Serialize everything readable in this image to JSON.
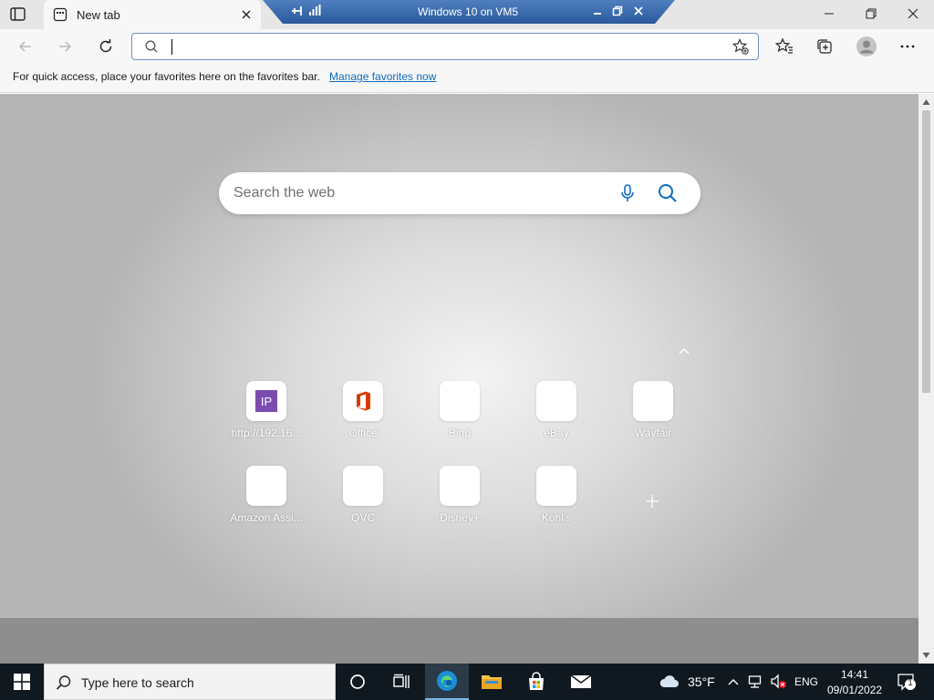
{
  "tab": {
    "title": "New tab"
  },
  "vm_bar": {
    "title": "Windows 10 on VM5"
  },
  "address": {
    "value": ""
  },
  "favorites_bar": {
    "message": "For quick access, place your favorites here on the favorites bar.",
    "link": "Manage favorites now"
  },
  "search": {
    "placeholder": "Search the web"
  },
  "quick_links": [
    {
      "label": "http://192.16...",
      "icon": "ip-icon"
    },
    {
      "label": "Office",
      "icon": "office-icon"
    },
    {
      "label": "Bing",
      "icon": "blank"
    },
    {
      "label": "eBay",
      "icon": "blank"
    },
    {
      "label": "Wayfair",
      "icon": "blank"
    },
    {
      "label": "Amazon Assi...",
      "icon": "blank"
    },
    {
      "label": "QVC",
      "icon": "blank"
    },
    {
      "label": "Disney+",
      "icon": "blank"
    },
    {
      "label": "Kohl's",
      "icon": "blank"
    }
  ],
  "ip_tile_text": "IP",
  "taskbar": {
    "search_placeholder": "Type here to search",
    "weather": "35°F",
    "language": "ENG",
    "time": "14:41",
    "date": "09/01/2022",
    "notification_count": "1"
  },
  "colors": {
    "accent": "#0f6cbd",
    "taskbar": "#101820",
    "address_border": "#6e8fbf"
  }
}
